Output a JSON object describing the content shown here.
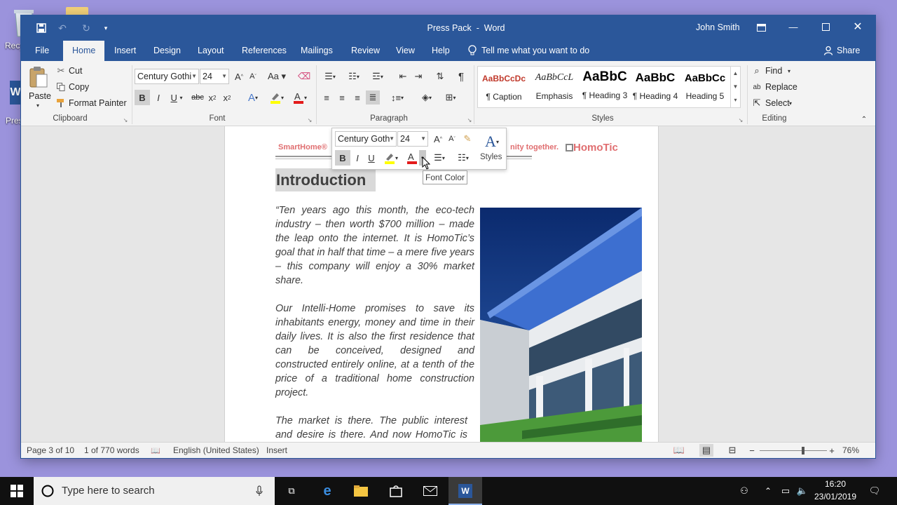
{
  "desktop": {
    "icons": [
      {
        "label": "Recy",
        "icon": "recycle-bin-icon"
      },
      {
        "label": "Pres",
        "icon": "word-doc-icon"
      }
    ]
  },
  "window": {
    "title": "Press Pack  -  Word",
    "user": "John Smith",
    "tabs": [
      "File",
      "Home",
      "Insert",
      "Design",
      "Layout",
      "References",
      "Mailings",
      "Review",
      "View",
      "Help"
    ],
    "active_tab": "Home",
    "tell_me": "Tell me what you want to do",
    "share": "Share"
  },
  "ribbon": {
    "clipboard": {
      "label": "Clipboard",
      "paste": "Paste",
      "cut": "Cut",
      "copy": "Copy",
      "format_painter": "Format Painter"
    },
    "font": {
      "label": "Font",
      "font_name": "Century Gothi",
      "font_size": "24"
    },
    "paragraph": {
      "label": "Paragraph"
    },
    "styles": {
      "label": "Styles",
      "items": [
        {
          "preview": "AaBbCcDc",
          "name": "¶ Caption",
          "color": "#c0392b"
        },
        {
          "preview": "AaBbCcL",
          "name": "Emphasis",
          "color": "#404040"
        },
        {
          "preview": "AaBbC",
          "name": "¶ Heading 3",
          "color": "#000000"
        },
        {
          "preview": "AaBbC",
          "name": "¶ Heading 4",
          "color": "#000000"
        },
        {
          "preview": "AaBbCc",
          "name": "Heading 5",
          "color": "#000000"
        }
      ]
    },
    "editing": {
      "label": "Editing",
      "find": "Find",
      "replace": "Replace",
      "select": "Select"
    }
  },
  "document": {
    "header_left": "SmartHome®",
    "header_mid": "nity together.",
    "logo": "HomoTic",
    "heading": "Introduction",
    "paragraphs": [
      "“Ten years ago this month, the eco-tech industry – then worth $700 million – made the leap onto the internet. It is HomoTic’s goal that in half that time – a mere five years – this company will enjoy a 30% market share.",
      "Our Intelli-Home promises to save its inhabitants energy, money and time in their daily lives. It is also the first residence that can be conceived, designed and constructed entirely online, at a tenth of the price of a traditional home construction project.",
      "The market is there. The public interest and desire is there. And now HomoTic is"
    ]
  },
  "mini_toolbar": {
    "font_name": "Century Goth",
    "font_size": "24",
    "styles_label": "Styles",
    "tooltip": "Font Color"
  },
  "status": {
    "page": "Page 3 of 10",
    "words": "1 of 770 words",
    "language": "English (United States)",
    "mode": "Insert",
    "zoom": "76%",
    "zoom_level": 0.38
  },
  "taskbar": {
    "search_placeholder": "Type here to search",
    "time": "16:20",
    "date": "23/01/2019"
  },
  "colors": {
    "accent": "#2b579a",
    "font_color_red": "#e31b1b",
    "highlight": "#ffff00"
  }
}
